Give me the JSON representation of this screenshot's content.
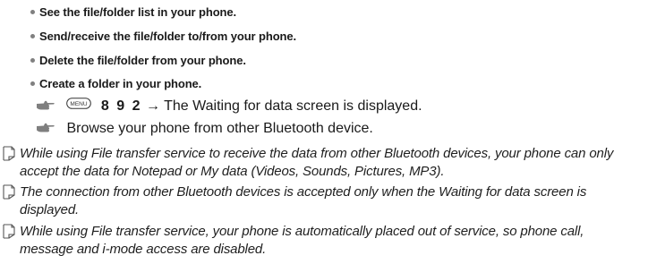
{
  "bullets": [
    "See the file/folder list in your phone.",
    "Send/receive the file/folder to/from your phone.",
    "Delete the file/folder from your phone.",
    "Create a folder in your phone."
  ],
  "steps": {
    "menu_key_label": "MENU",
    "step1_keys": "8 9 2",
    "step1_arrow": "→",
    "step1_text": "The Waiting for data screen is displayed.",
    "step2_text": "Browse your phone from other Bluetooth device."
  },
  "notes": [
    {
      "line1": "While using File transfer service to receive the data from other Bluetooth devices, your phone can only",
      "line2": "accept the data for Notepad or My data (Videos, Sounds, Pictures, MP3)."
    },
    {
      "line1": "The connection from other Bluetooth devices is accepted only when the Waiting for data screen is",
      "line2": "displayed."
    },
    {
      "line1": "While using File transfer service, your phone is automatically placed out of service, so phone call,",
      "line2": "message and i-mode access are disabled."
    }
  ],
  "icons": {
    "bullet": "bullet-dot",
    "step": "pointing-hand-icon",
    "note": "memo-note-icon",
    "menu": "menu-key-icon"
  }
}
